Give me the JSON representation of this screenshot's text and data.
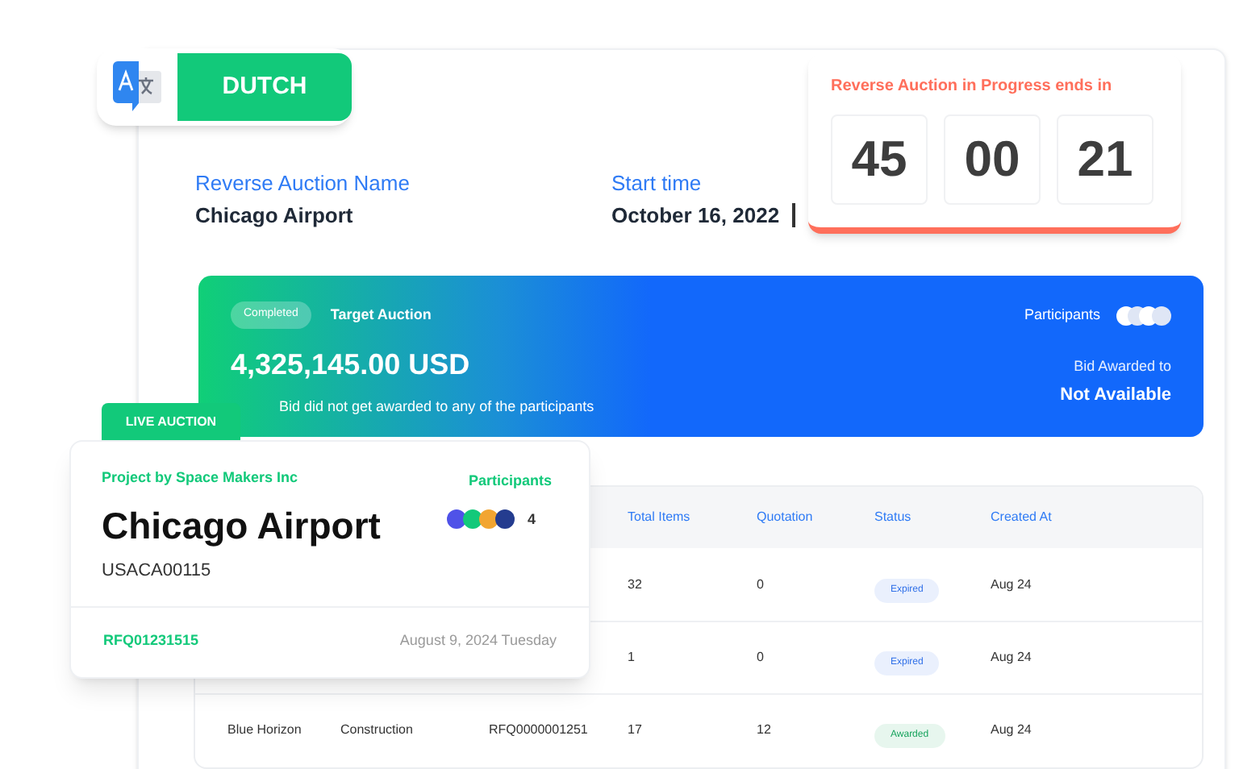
{
  "language_badge": {
    "label": "DUTCH"
  },
  "auction_info": [
    {
      "label": "Reverse Auction Name",
      "value": "Chicago Airport"
    },
    {
      "label": "Start time",
      "value": "October 16, 2022"
    }
  ],
  "countdown": {
    "title": "Reverse Auction in Progress ends in",
    "digits": [
      "45",
      "00",
      "21"
    ]
  },
  "banner": {
    "status": "Completed",
    "title": "Target Auction",
    "amount": "4,325,145.00 USD",
    "note": "Bid did not get awarded to any of the participants",
    "participants_label": "Participants",
    "awarded_label": "Bid Awarded to",
    "awarded_value": "Not Available"
  },
  "table": {
    "columns": [
      "Total Items",
      "Quotation",
      "Status",
      "Created At"
    ],
    "rows": [
      {
        "cells": [],
        "total_items": "32",
        "quotation": "0",
        "status": {
          "text": "Expired",
          "color": "#2f6fe8"
        },
        "created_at": "Aug 24"
      },
      {
        "cells": [],
        "total_items": "1",
        "quotation": "0",
        "status": {
          "text": "Expired",
          "color": "#2f6fe8"
        },
        "created_at": "Aug 24"
      },
      {
        "cells": [
          "Blue Horizon",
          "Construction",
          "RFQ0000001251"
        ],
        "total_items": "17",
        "quotation": "12",
        "status": {
          "text": "Awarded",
          "color": "#16a35c"
        },
        "created_at": "Aug 24"
      }
    ]
  },
  "live_card": {
    "tag": "LIVE AUCTION",
    "project": "Project by Space Makers Inc",
    "title": "Chicago Airport",
    "code": "USACA00115",
    "participants_label": "Participants",
    "avatars": [
      {
        "color": "#4f52e8"
      },
      {
        "color": "#12c97a"
      },
      {
        "color": "#f2a531"
      },
      {
        "color": "#243c8f"
      }
    ],
    "count": "4",
    "rfq": "RFQ01231515",
    "date": "August 9, 2024 Tuesday"
  }
}
